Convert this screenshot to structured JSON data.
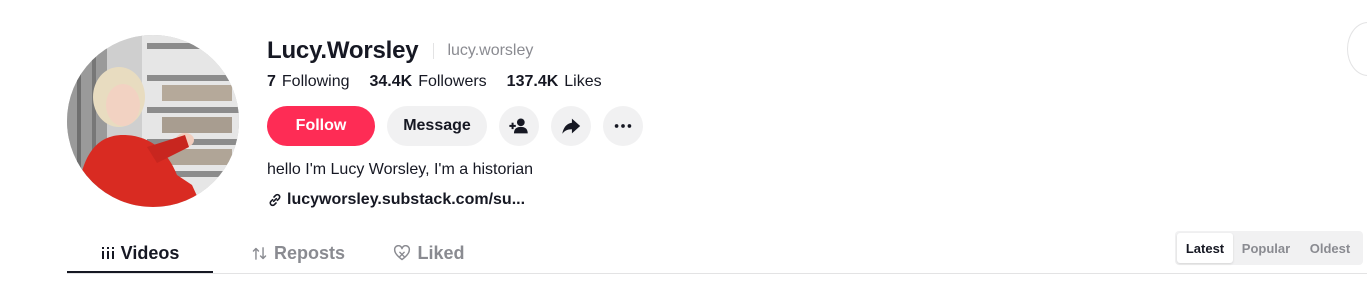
{
  "profile": {
    "display_name": "Lucy.Worsley",
    "username": "lucy.worsley",
    "bio": "hello I'm Lucy Worsley, I'm a historian",
    "link": "lucyworsley.substack.com/su..."
  },
  "stats": {
    "following": {
      "value": "7",
      "label": "Following"
    },
    "followers": {
      "value": "34.4K",
      "label": "Followers"
    },
    "likes": {
      "value": "137.4K",
      "label": "Likes"
    }
  },
  "actions": {
    "follow_label": "Follow",
    "message_label": "Message",
    "icons": [
      "add-friend-icon",
      "share-icon",
      "more-icon"
    ]
  },
  "tabs": [
    {
      "label": "Videos",
      "icon": "grid-icon",
      "active": true
    },
    {
      "label": "Reposts",
      "icon": "repost-icon",
      "active": false
    },
    {
      "label": "Liked",
      "icon": "heart-icon",
      "active": false
    }
  ],
  "sort": {
    "options": [
      "Latest",
      "Popular",
      "Oldest"
    ],
    "selected": "Latest"
  },
  "colors": {
    "accent": "#fe2c55",
    "text": "#161823",
    "muted": "#8a8b91",
    "button_bg": "#f1f1f2"
  }
}
